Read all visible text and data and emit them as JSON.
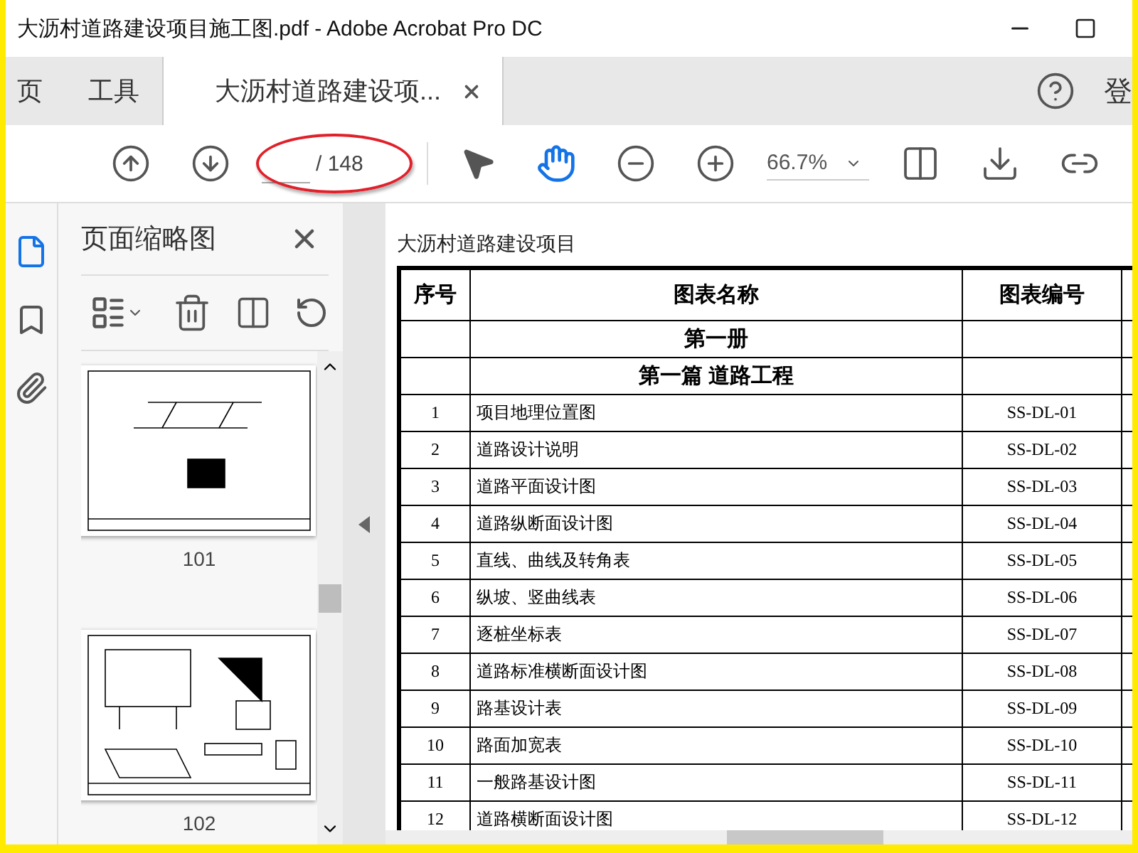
{
  "window": {
    "title": "大沥村道路建设项目施工图.pdf - Adobe Acrobat Pro DC"
  },
  "tabs": [
    {
      "label": "页",
      "selected": false
    },
    {
      "label": "工具",
      "selected": false
    },
    {
      "label": "大沥村道路建设项...",
      "selected": true,
      "closable": true
    }
  ],
  "account": {
    "label": "登"
  },
  "toolbar": {
    "page_total": "/ 148",
    "zoom": "66.7%",
    "annotated": true
  },
  "side_panel": {
    "title": "页面缩略图",
    "thumbnails": [
      {
        "page": "101",
        "kind": "plan"
      },
      {
        "page": "102",
        "kind": "detail"
      }
    ]
  },
  "document": {
    "header": "大沥村道路建设项目",
    "columns": [
      "序号",
      "图表名称",
      "图表编号"
    ],
    "rows": [
      {
        "kind": "heading",
        "name": "第一册"
      },
      {
        "kind": "heading",
        "name": "第一篇  道路工程"
      },
      {
        "kind": "item",
        "no": "1",
        "name": "项目地理位置图",
        "code": "SS-DL-01"
      },
      {
        "kind": "item",
        "no": "2",
        "name": "道路设计说明",
        "code": "SS-DL-02"
      },
      {
        "kind": "item",
        "no": "3",
        "name": "道路平面设计图",
        "code": "SS-DL-03"
      },
      {
        "kind": "item",
        "no": "4",
        "name": "道路纵断面设计图",
        "code": "SS-DL-04"
      },
      {
        "kind": "item",
        "no": "5",
        "name": "直线、曲线及转角表",
        "code": "SS-DL-05"
      },
      {
        "kind": "item",
        "no": "6",
        "name": "纵坡、竖曲线表",
        "code": "SS-DL-06"
      },
      {
        "kind": "item",
        "no": "7",
        "name": "逐桩坐标表",
        "code": "SS-DL-07"
      },
      {
        "kind": "item",
        "no": "8",
        "name": "道路标准横断面设计图",
        "code": "SS-DL-08"
      },
      {
        "kind": "item",
        "no": "9",
        "name": "路基设计表",
        "code": "SS-DL-09"
      },
      {
        "kind": "item",
        "no": "10",
        "name": "路面加宽表",
        "code": "SS-DL-10"
      },
      {
        "kind": "item",
        "no": "11",
        "name": "一般路基设计图",
        "code": "SS-DL-11"
      },
      {
        "kind": "item",
        "no": "12",
        "name": "道路横断面设计图",
        "code": "SS-DL-12"
      }
    ]
  }
}
